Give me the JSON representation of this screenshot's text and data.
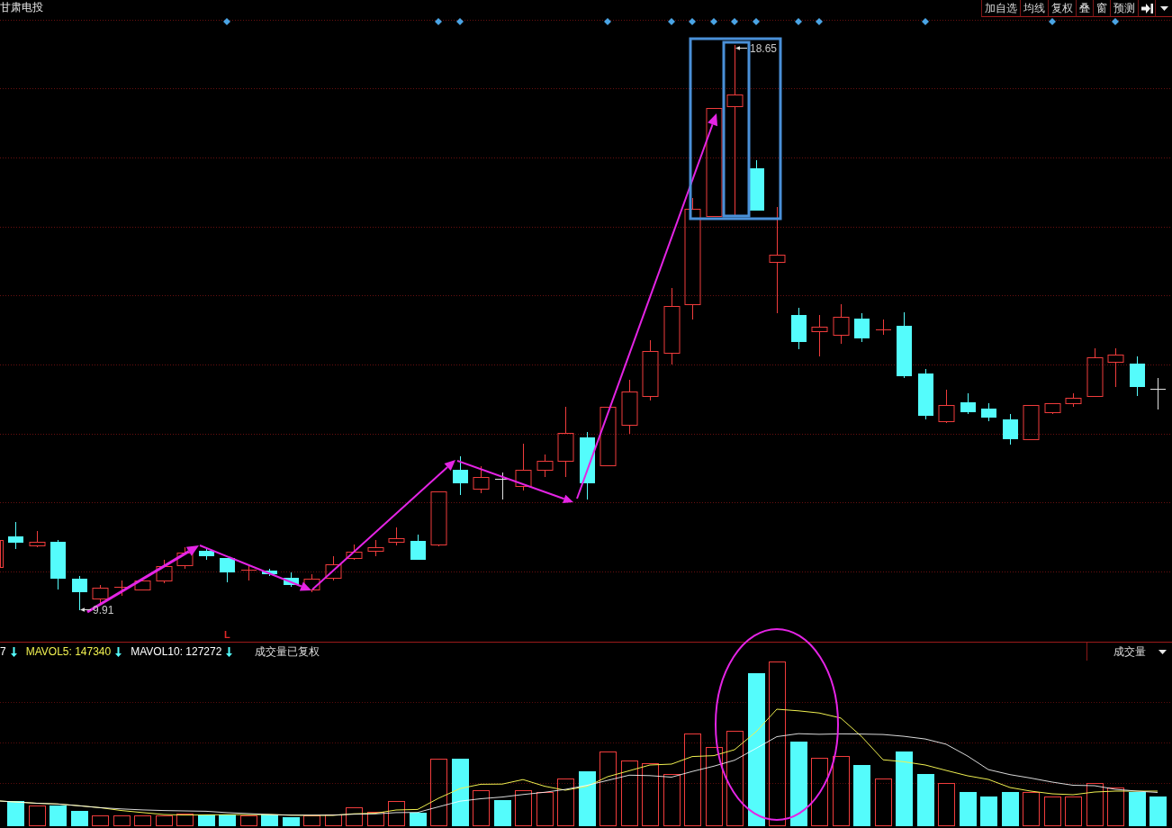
{
  "window": {
    "title": "甘肃电投"
  },
  "toolbar": {
    "buttons": [
      "加自选",
      "均线",
      "复权",
      "叠",
      "窗",
      "预测"
    ]
  },
  "price_chart": {
    "high_label": "18.65",
    "low_label": "9.91",
    "marker": "L"
  },
  "volume_panel": {
    "legend": [
      {
        "text": "7",
        "color": "#ffffff",
        "falling": true
      },
      {
        "text": "MAVOL5: 147340",
        "color": "#f0f050",
        "falling": true
      },
      {
        "text": "MAVOL10: 127272",
        "color": "#ffffff",
        "falling": true
      }
    ],
    "note": "成交量已复权",
    "indicator": "成交量"
  }
}
